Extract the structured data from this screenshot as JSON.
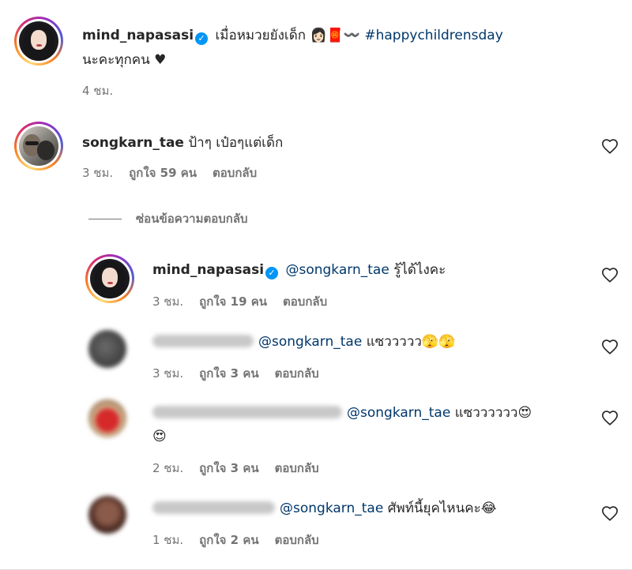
{
  "post": {
    "username": "mind_napasasi",
    "caption_part1": "เมื่อหมวยยังเด็ก",
    "caption_emojis": "👩🏻🧧〰️",
    "hashtag": "#happychildrensday",
    "caption_line2": "นะคะทุกคน ♥",
    "time": "4 ชม."
  },
  "comments": [
    {
      "username": "songkarn_tae",
      "text": "ป้าๆ เป๋อๆแต่เด็ก",
      "time": "3 ชม.",
      "likes": "ถูกใจ 59 คน",
      "reply_label": "ตอบกลับ"
    }
  ],
  "hide_replies_label": "ซ่อนข้อความตอบกลับ",
  "replies": [
    {
      "username": "mind_napasasi",
      "mention": "@songkarn_tae",
      "text": "รู้ได้ไงคะ",
      "time": "3 ชม.",
      "likes": "ถูกใจ 19 คน",
      "reply_label": "ตอบกลับ"
    },
    {
      "username_hidden": true,
      "mention": "@songkarn_tae",
      "text": "แซววววว🫣🫣",
      "time": "3 ชม.",
      "likes": "ถูกใจ 3 คน",
      "reply_label": "ตอบกลับ"
    },
    {
      "username_hidden": true,
      "mention": "@songkarn_tae",
      "text": "แซวววววว😍",
      "text_line2": "😍",
      "time": "2 ชม.",
      "likes": "ถูกใจ 3 คน",
      "reply_label": "ตอบกลับ"
    },
    {
      "username_hidden": true,
      "mention": "@songkarn_tae",
      "text": "ศัพท์นี้ยุคไหนคะ😂",
      "time": "1 ชม.",
      "likes": "ถูกใจ 2 คน",
      "reply_label": "ตอบกลับ"
    }
  ],
  "icons": {
    "verified": "verified-badge-icon",
    "heart": "heart-outline-icon"
  },
  "colors": {
    "mention": "#00376b",
    "verified": "#0095f6",
    "meta": "#737373"
  }
}
